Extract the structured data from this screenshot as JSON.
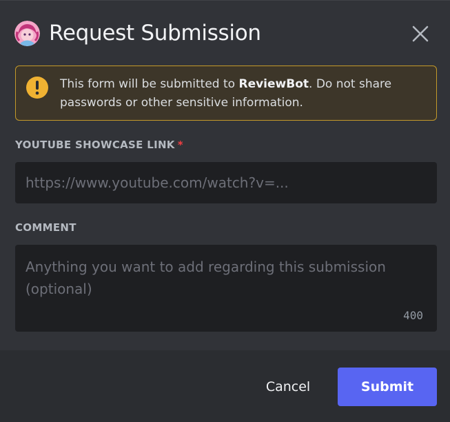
{
  "modal": {
    "title": "Request Submission",
    "close_icon": "close-icon",
    "avatar_icon": "bot-avatar"
  },
  "notice": {
    "icon": "warning-icon",
    "text_before": "This form will be submitted to ",
    "bot_name": "ReviewBot",
    "text_after": ". Do not share passwords or other sensitive information."
  },
  "fields": {
    "youtube": {
      "label": "YOUTUBE SHOWCASE LINK",
      "required_marker": "*",
      "value": "",
      "placeholder": "https://www.youtube.com/watch?v=..."
    },
    "comment": {
      "label": "COMMENT",
      "value": "",
      "placeholder": "Anything you want to add regarding this submission (optional)",
      "char_counter": "400"
    }
  },
  "footer": {
    "cancel_label": "Cancel",
    "submit_label": "Submit"
  },
  "colors": {
    "background": "#313338",
    "footer_background": "#2b2d31",
    "input_background": "#1e1f22",
    "notice_border": "#c49a2a",
    "notice_background": "#3d3629",
    "warning": "#f0b232",
    "required": "#f23f43",
    "primary_button": "#5865f2"
  }
}
